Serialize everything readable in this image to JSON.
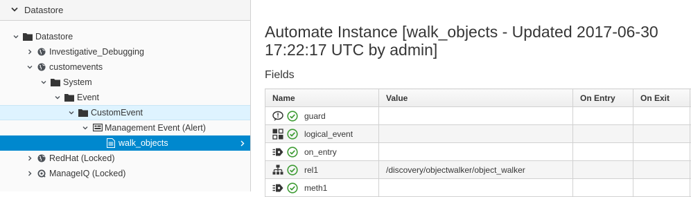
{
  "accordion": {
    "title": "Datastore"
  },
  "tree": [
    {
      "label": "Datastore",
      "icon": "folder-icon",
      "toggle": "expanded",
      "level": 0
    },
    {
      "label": "Investigative_Debugging",
      "icon": "globe-icon",
      "toggle": "collapsed",
      "level": 1
    },
    {
      "label": "customevents",
      "icon": "globe-icon",
      "toggle": "expanded",
      "level": 1
    },
    {
      "label": "System",
      "icon": "folder-icon",
      "toggle": "expanded",
      "level": 2
    },
    {
      "label": "Event",
      "icon": "folder-icon",
      "toggle": "expanded",
      "level": 3
    },
    {
      "label": "CustomEvent",
      "icon": "folder-icon",
      "toggle": "expanded",
      "level": 4
    },
    {
      "label": "Management Event (Alert)",
      "icon": "class-icon",
      "toggle": "expanded",
      "level": 5
    },
    {
      "label": "walk_objects",
      "icon": "instance-icon",
      "toggle": "none",
      "level": 6
    },
    {
      "label": "RedHat (Locked)",
      "icon": "globe-icon",
      "toggle": "collapsed",
      "level": 1
    },
    {
      "label": "ManageIQ (Locked)",
      "icon": "lock-icon",
      "toggle": "collapsed",
      "level": 1
    }
  ],
  "main": {
    "title": "Automate Instance [walk_objects - Updated 2017-06-30 17:22:17 UTC by admin]",
    "section": "Fields",
    "columns": [
      "Name",
      "Value",
      "On Entry",
      "On Exit",
      ""
    ],
    "rows": [
      {
        "icon": "guard-icon",
        "name": "guard",
        "value": "",
        "on_entry": "",
        "on_exit": ""
      },
      {
        "icon": "logical-event-icon",
        "name": "logical_event",
        "value": "",
        "on_entry": "",
        "on_exit": ""
      },
      {
        "icon": "on-entry-icon",
        "name": "on_entry",
        "value": "",
        "on_entry": "",
        "on_exit": ""
      },
      {
        "icon": "relationship-icon",
        "name": "rel1",
        "value": "/discovery/objectwalker/object_walker",
        "on_entry": "",
        "on_exit": ""
      },
      {
        "icon": "method-icon",
        "name": "meth1",
        "value": "",
        "on_entry": "",
        "on_exit": ""
      }
    ]
  },
  "colors": {
    "selected": "#0088ce",
    "parent_highlight": "#def3ff",
    "ok_green": "#3f9c35"
  }
}
